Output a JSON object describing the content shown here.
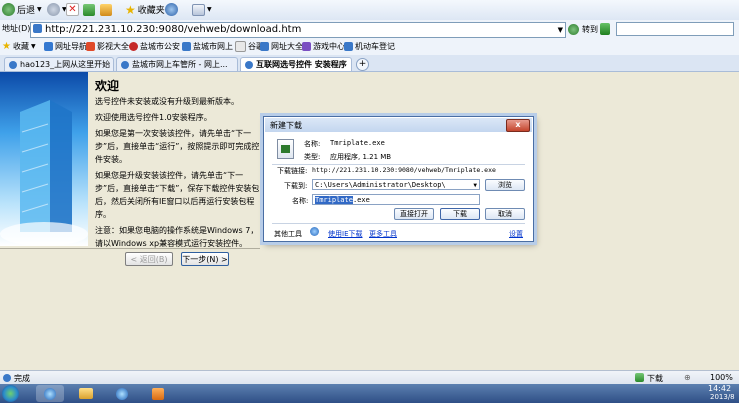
{
  "toolbar": {
    "back_label": "后退",
    "favorites_label": "收藏夹"
  },
  "address": {
    "label": "地址(D)",
    "url": "http://221.231.10.230:9080/vehweb/download.htm",
    "go_label": "转到"
  },
  "favorites_bar": {
    "label": "收藏",
    "items": [
      "网址导航",
      "影视大全",
      "盐城市公安",
      "盐城市网上",
      "谷歌",
      "网址大全",
      "游戏中心",
      "机动车登记"
    ]
  },
  "tabs": [
    {
      "label": "hao123_上网从这里开始"
    },
    {
      "label": "盐城市网上车管所 - 网上..."
    },
    {
      "label": "互联网选号控件 安装程序"
    }
  ],
  "wizard": {
    "title": "欢迎",
    "subtitle": "选号控件未安装或没有升级到最新版本。",
    "para1": "欢迎使用选号控件1.0安装程序。",
    "para2": "如果您是第一次安装该控件，请先单击“下一步”后，直接单击“运行”，按照提示即可完成控件安装。",
    "para3": "如果您是升级安装该控件，请先单击“下一步”后，直接单击“下载”，保存下载控件安装包后，然后关闭所有IE窗口以后再运行安装包程序。",
    "para4": "注意：如果您电脑的操作系统是Windows 7，请以Windows xp兼容模式运行安装控件。",
    "back_button": "< 返回(B)",
    "next_button": "下一步(N) >"
  },
  "dialog": {
    "title": "新建下载",
    "close_label": "x",
    "name_label": "名称:",
    "name_value": "Tmriplate.exe",
    "type_label": "类型:",
    "type_value": "应用程序, 1.21 MB",
    "link_label": "下载链接:",
    "link_value": "http://221.231.10.230:9080/vehweb/Tmriplate.exe",
    "saveto_label": "下载到:",
    "saveto_value": "C:\\Users\\Administrator\\Desktop\\",
    "browse_button": "浏览",
    "filename_label": "名称:",
    "filename_selected": "Tmriplate",
    "filename_ext": ".exe",
    "open_button": "直接打开",
    "download_button": "下载",
    "cancel_button": "取消",
    "other_tools": "其他工具",
    "use_ie_link": "使用IE下载",
    "more_tools_link": "更多工具",
    "settings_link": "设置"
  },
  "statusbar": {
    "status": "完成",
    "download_label": "下载",
    "zoom": "100%"
  },
  "taskbar": {
    "time": "14:42",
    "date": "2013/8"
  }
}
